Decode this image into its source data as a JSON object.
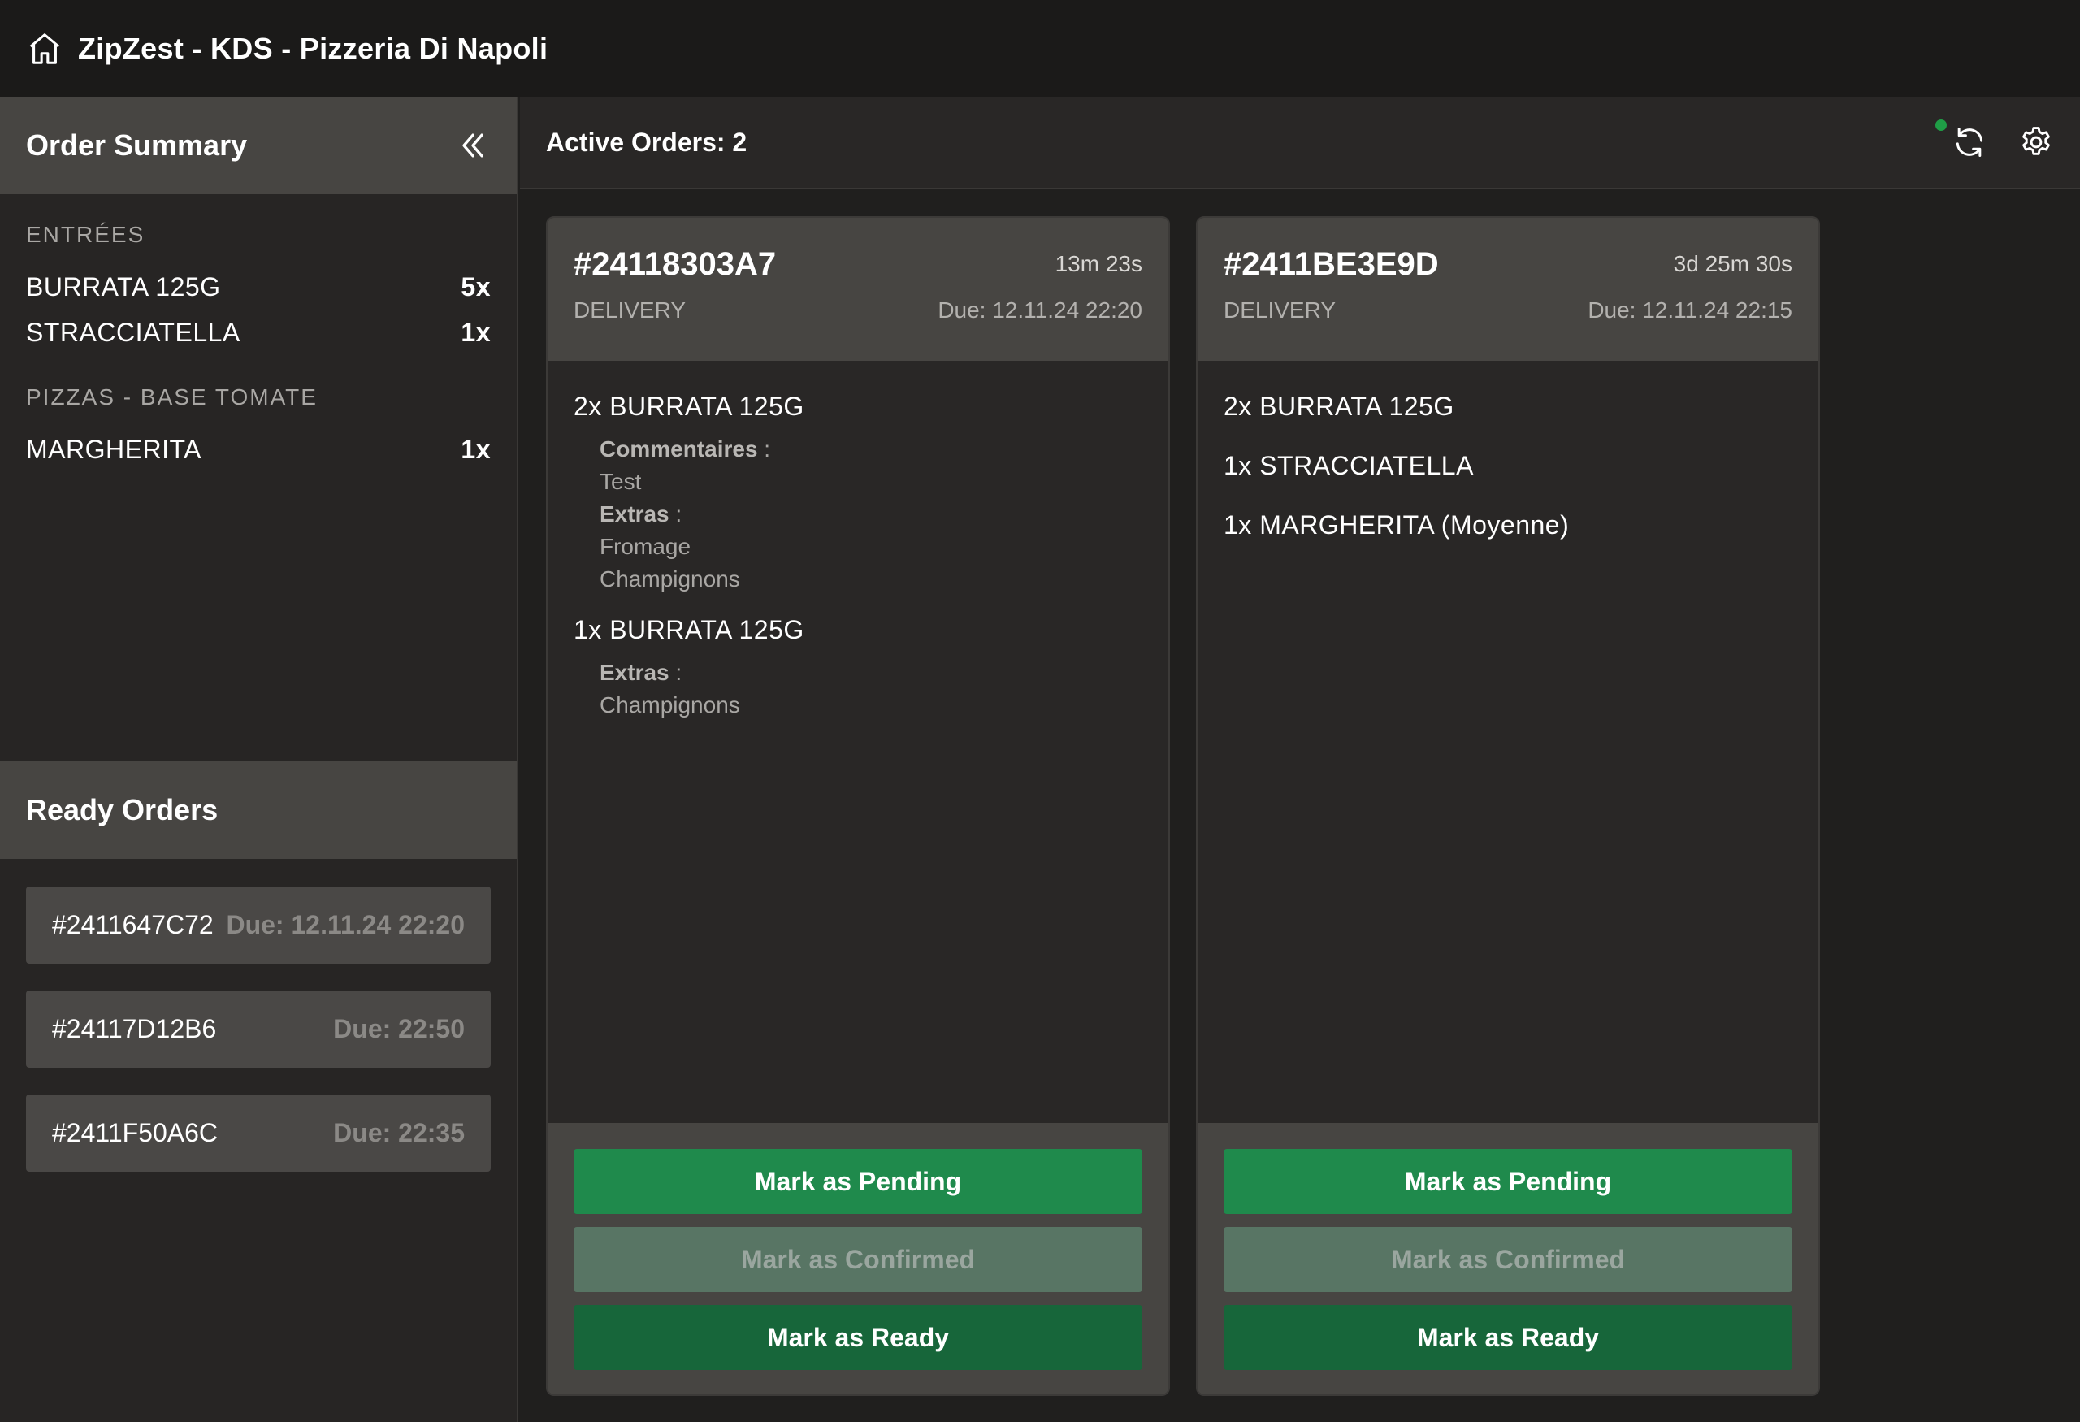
{
  "app": {
    "title": "ZipZest - KDS - Pizzeria Di Napoli"
  },
  "sidebar": {
    "summary_title": "Order Summary",
    "categories": [
      {
        "name": "ENTRÉES",
        "items": [
          {
            "name": "BURRATA 125G",
            "qty": "5x"
          },
          {
            "name": "STRACCIATELLA",
            "qty": "1x"
          }
        ]
      },
      {
        "name": "PIZZAS - BASE TOMATE",
        "items": [
          {
            "name": "MARGHERITA",
            "qty": "1x"
          }
        ]
      }
    ],
    "ready_title": "Ready Orders",
    "ready_orders": [
      {
        "id": "#2411647C72",
        "due": "Due: 12.11.24 22:20"
      },
      {
        "id": "#24117D12B6",
        "due": "Due: 22:50"
      },
      {
        "id": "#2411F50A6C",
        "due": "Due: 22:35"
      }
    ]
  },
  "main": {
    "active_label": "Active Orders: 2",
    "status_color": "#1f9d46",
    "orders": [
      {
        "id": "#24118303A7",
        "elapsed": "13m 23s",
        "type": "DELIVERY",
        "due": "Due: 12.11.24 22:20",
        "items": [
          {
            "title": "2x BURRATA 125G",
            "comments_label": "Commentaires",
            "comments": [
              "Test"
            ],
            "extras_label": "Extras",
            "extras": [
              "Fromage",
              "Champignons"
            ]
          },
          {
            "title": "1x BURRATA 125G",
            "extras_label": "Extras",
            "extras": [
              "Champignons"
            ]
          }
        ],
        "buttons": {
          "pending": "Mark as Pending",
          "confirmed": "Mark as Confirmed",
          "ready": "Mark as Ready"
        }
      },
      {
        "id": "#2411BE3E9D",
        "elapsed": "3d 25m 30s",
        "type": "DELIVERY",
        "due": "Due: 12.11.24 22:15",
        "items": [
          {
            "title": "2x BURRATA 125G"
          },
          {
            "title": "1x STRACCIATELLA"
          },
          {
            "title": "1x MARGHERITA (Moyenne)"
          }
        ],
        "buttons": {
          "pending": "Mark as Pending",
          "confirmed": "Mark as Confirmed",
          "ready": "Mark as Ready"
        }
      }
    ]
  }
}
